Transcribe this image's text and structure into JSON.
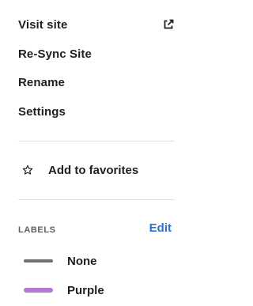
{
  "menu": {
    "visit_site": "Visit site",
    "resync_site": "Re-Sync Site",
    "rename": "Rename",
    "settings": "Settings",
    "favorites": "Add to favorites"
  },
  "labels": {
    "header": "LABELS",
    "edit": "Edit",
    "items": [
      {
        "name": "None",
        "color": "#6f6f6f"
      },
      {
        "name": "Purple",
        "color": "#b57ad6"
      }
    ]
  },
  "icons": {
    "visit_site": "external-link-icon",
    "favorites": "star-outline-icon"
  },
  "colors": {
    "accent": "#2f6ed3",
    "text": "#1f1f1f",
    "muted": "#5f5f5f",
    "divider": "#e2e2e2"
  }
}
